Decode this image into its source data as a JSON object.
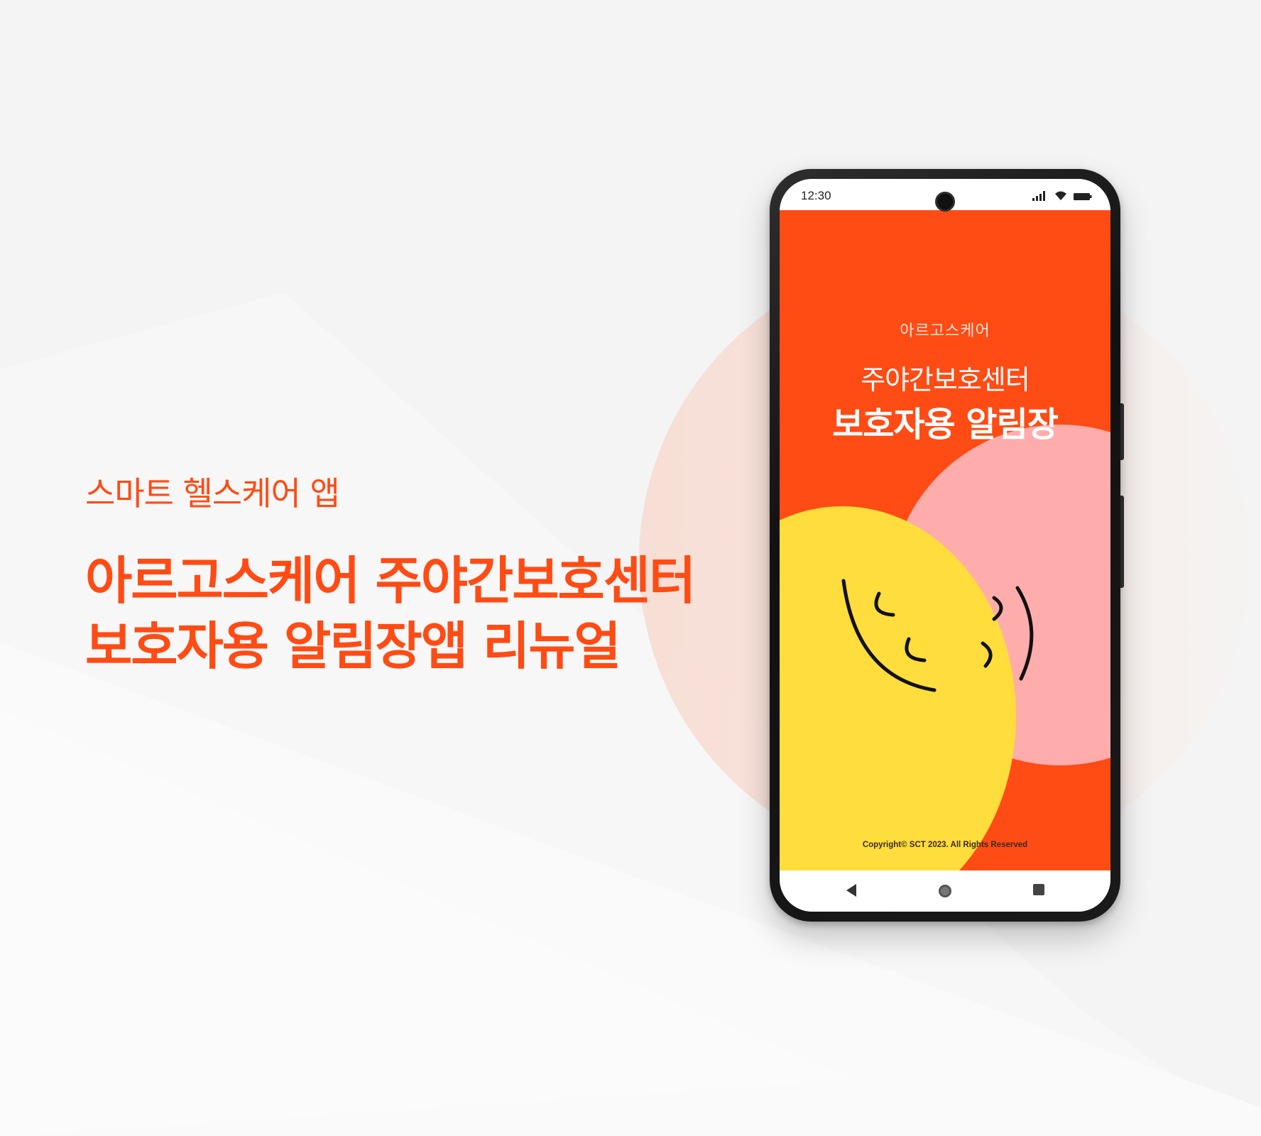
{
  "colors": {
    "accent": "#ff4b14",
    "yellow": "#ffdd3c",
    "pink": "#ffacac",
    "background": "#f4f4f4"
  },
  "hero": {
    "eyebrow": "스마트 헬스케어 앱",
    "headline_line1": "아르고스케어 주야간보호센터",
    "headline_line2": "보호자용 알림장앱 리뉴얼"
  },
  "phone": {
    "status_time": "12:30",
    "status_icons": [
      "signal-icon",
      "wifi-icon",
      "battery-icon"
    ],
    "app": {
      "brand": "아르고스케어",
      "title_line1": "주야간보호센터",
      "title_line2": "보호자용 알림장",
      "copyright": "Copyright© SCT 2023. All Rights Reserved"
    },
    "nav_buttons": [
      "back-icon",
      "home-icon",
      "recents-icon"
    ]
  }
}
